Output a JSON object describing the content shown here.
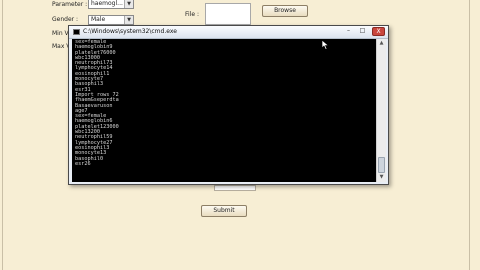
{
  "form": {
    "parameter_label": "Parameter :",
    "parameter_value": "haemogl...",
    "gender_label": "Gender :",
    "gender_value": "Male",
    "min_label": "Min Val",
    "max_label": "Max Va",
    "file_label": "File :",
    "browse_label": "Browse",
    "submit_label": "Submit"
  },
  "console": {
    "title": "C:\\Windows\\system32\\cmd.exe",
    "minimize_glyph": "–",
    "maximize_glyph": "□",
    "close_glyph": "X",
    "lines": [
      "sex=female",
      "haemoglobin9",
      "platelet76000",
      "wbc13000",
      "neutrophil73",
      "lymphocyte14",
      "eosinophil1",
      "monocyte7",
      "basophil3",
      "esr31",
      "Import rows 72",
      "fhaemGseperdta",
      "Basaevaruson",
      "age7",
      "sex=female",
      "haemoglobin6",
      "platelet123000",
      "wbc13200",
      "neutrophil59",
      "lymphocyte27",
      "eosinophil3",
      "monocyte13",
      "basophil0",
      "esr26"
    ]
  },
  "icons": {
    "dropdown": "chevron-down-icon",
    "console": "console-icon",
    "cursor": "mouse-pointer-icon"
  }
}
